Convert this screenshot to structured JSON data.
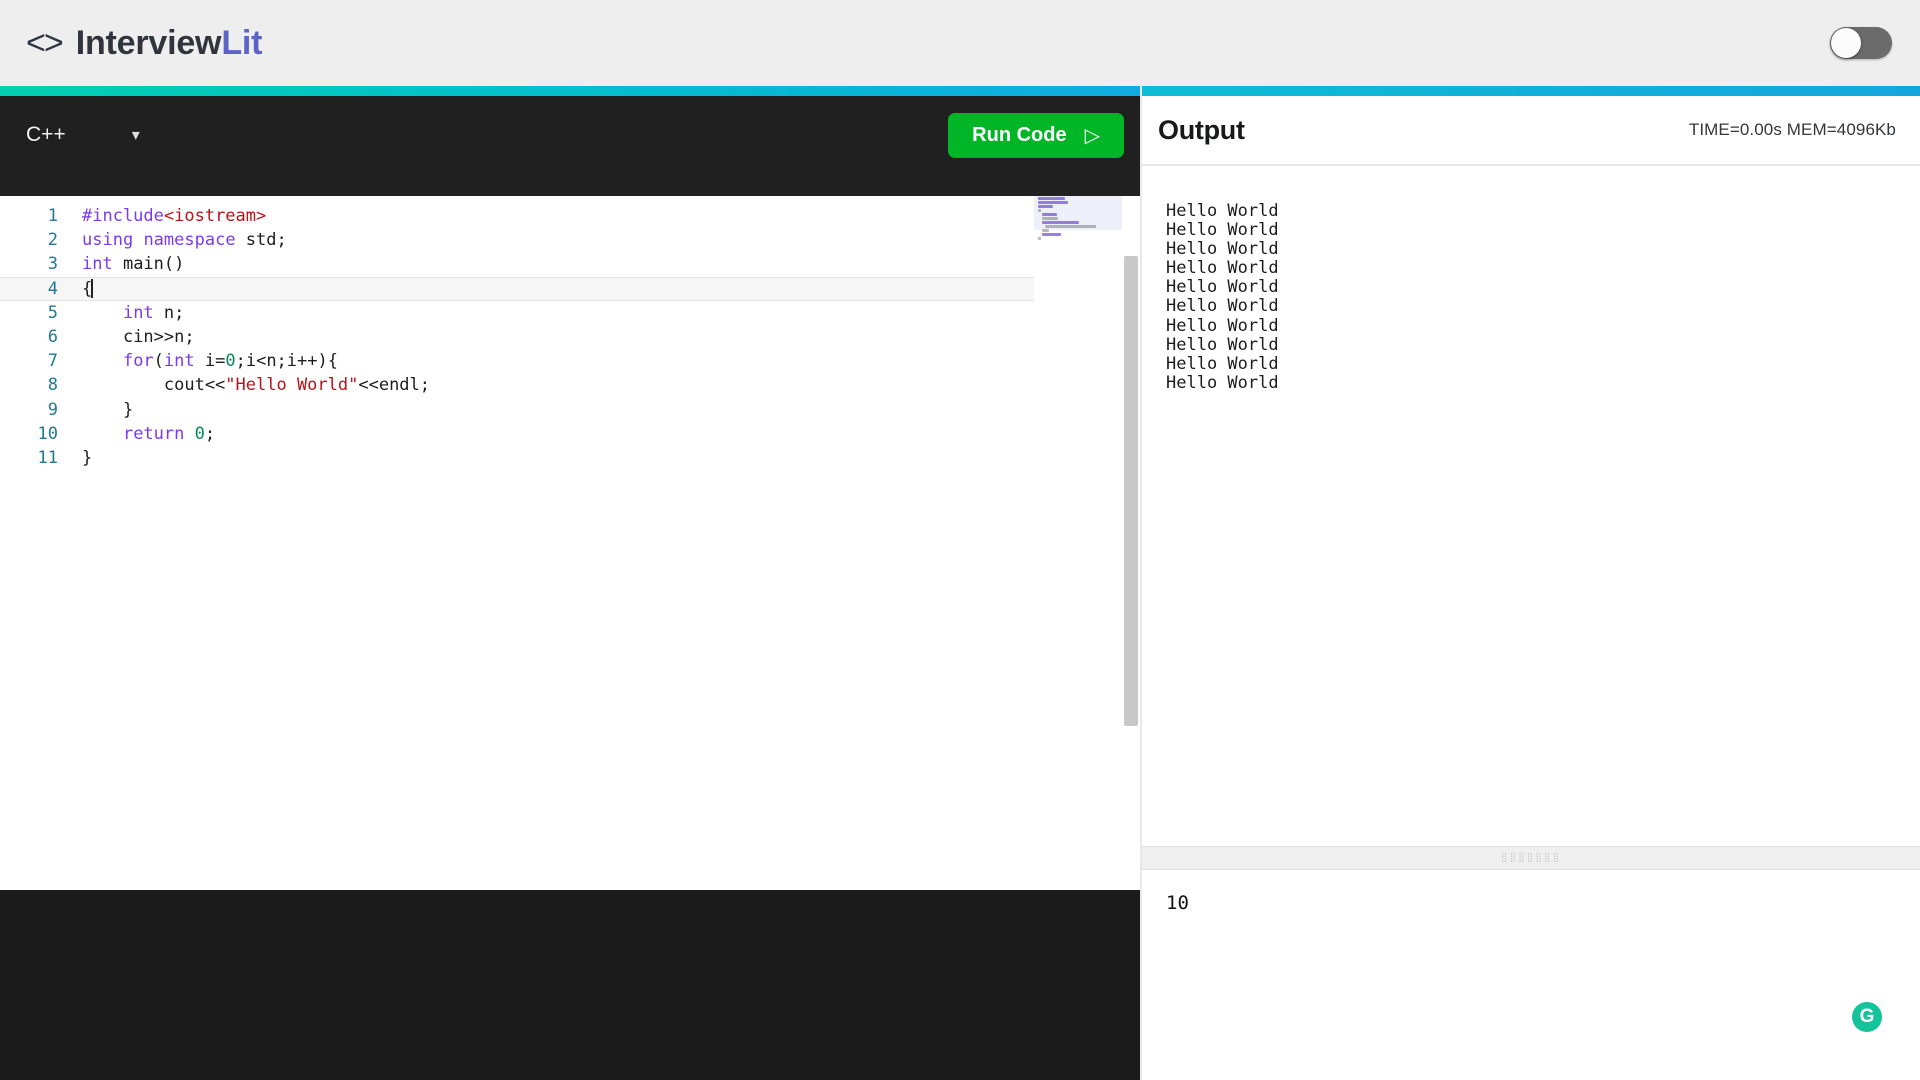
{
  "header": {
    "logo_icon": "code-brackets-icon",
    "brand_prefix": "Interview",
    "brand_accent": "Lit",
    "toggle_state": "off"
  },
  "editor": {
    "language": "C++",
    "dropdown_icon": "chevron-down-icon",
    "run_label": "Run Code",
    "run_icon": "play-triangle-icon",
    "accent_green": "#00b626",
    "gradient_from": "#00d0b0",
    "gradient_to": "#10ace0",
    "active_line": 4,
    "lines": [
      {
        "n": "1",
        "tokens": [
          {
            "t": "#include",
            "c": "pp"
          },
          {
            "t": "<iostream>",
            "c": "inc"
          }
        ]
      },
      {
        "n": "2",
        "tokens": [
          {
            "t": "using",
            "c": "kw"
          },
          {
            "t": " ",
            "c": "fn"
          },
          {
            "t": "namespace",
            "c": "kw"
          },
          {
            "t": " std;",
            "c": "fn"
          }
        ]
      },
      {
        "n": "3",
        "tokens": [
          {
            "t": "int",
            "c": "kw"
          },
          {
            "t": " main()",
            "c": "fn"
          }
        ]
      },
      {
        "n": "4",
        "tokens": [
          {
            "t": "{",
            "c": "fn"
          }
        ]
      },
      {
        "n": "5",
        "tokens": [
          {
            "t": "    ",
            "c": "fn"
          },
          {
            "t": "int",
            "c": "kw"
          },
          {
            "t": " n;",
            "c": "fn"
          }
        ]
      },
      {
        "n": "6",
        "tokens": [
          {
            "t": "    cin>>n;",
            "c": "fn"
          }
        ]
      },
      {
        "n": "7",
        "tokens": [
          {
            "t": "    ",
            "c": "fn"
          },
          {
            "t": "for",
            "c": "kw"
          },
          {
            "t": "(",
            "c": "fn"
          },
          {
            "t": "int",
            "c": "kw"
          },
          {
            "t": " i=",
            "c": "fn"
          },
          {
            "t": "0",
            "c": "num"
          },
          {
            "t": ";i<n;i++){",
            "c": "fn"
          }
        ]
      },
      {
        "n": "8",
        "tokens": [
          {
            "t": "        cout<<",
            "c": "fn"
          },
          {
            "t": "\"Hello World\"",
            "c": "str"
          },
          {
            "t": "<<endl;",
            "c": "fn"
          }
        ]
      },
      {
        "n": "9",
        "tokens": [
          {
            "t": "    }",
            "c": "fn"
          }
        ]
      },
      {
        "n": "10",
        "tokens": [
          {
            "t": "    ",
            "c": "fn"
          },
          {
            "t": "return",
            "c": "kw"
          },
          {
            "t": " ",
            "c": "fn"
          },
          {
            "t": "0",
            "c": "num"
          },
          {
            "t": ";",
            "c": "fn"
          }
        ]
      },
      {
        "n": "11",
        "tokens": [
          {
            "t": "}",
            "c": "fn"
          }
        ]
      }
    ]
  },
  "output": {
    "title": "Output",
    "stats": "TIME=0.00s MEM=4096Kb",
    "console_lines": [
      "Hello World",
      "Hello World",
      "Hello World",
      "Hello World",
      "Hello World",
      "Hello World",
      "Hello World",
      "Hello World",
      "Hello World",
      "Hello World"
    ],
    "splitter_grip": "⣿⣿⣿⣿⣿⣿⣿",
    "stdin_value": "10",
    "grammarly_glyph": "G"
  }
}
